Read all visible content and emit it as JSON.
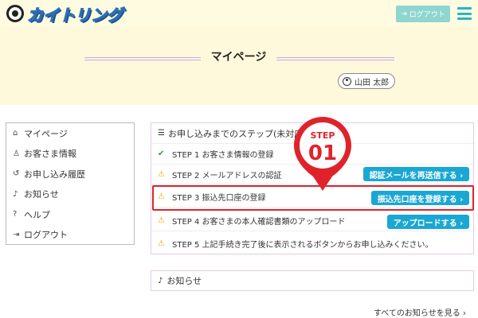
{
  "header": {
    "logo_text": "カイトリング",
    "logout_label": "ログアウト"
  },
  "hero": {
    "title": "マイページ",
    "user_name": "山田 太郎"
  },
  "sidebar": {
    "items": [
      {
        "icon": "home-icon",
        "label": "マイページ"
      },
      {
        "icon": "user-icon",
        "label": "お客さま情報"
      },
      {
        "icon": "history-icon",
        "label": "お申し込み履歴"
      },
      {
        "icon": "bell-icon",
        "label": "お知らせ"
      },
      {
        "icon": "help-icon",
        "label": "ヘルプ"
      },
      {
        "icon": "logout-icon",
        "label": "ログアウト"
      }
    ]
  },
  "steps": {
    "heading": "お申し込みまでのステップ(未対応の",
    "rows": [
      {
        "status": "done",
        "label": "STEP 1  お客さま情報の登録"
      },
      {
        "status": "todo",
        "label": "STEP 2  メールアドレスの認証",
        "button": "認証メールを再送信する ›"
      },
      {
        "status": "todo",
        "label": "STEP 3  振込先口座の登録",
        "button": "振込先口座を登録する ›"
      },
      {
        "status": "todo",
        "label": "STEP 4  お客さまの本人確認書類のアップロード",
        "button": "アップロードする ›"
      },
      {
        "status": "todo",
        "label": "STEP 5  上記手続き完了後に表示されるボタンからお申し込みください。"
      }
    ]
  },
  "badge": {
    "step_word": "STEP",
    "step_number": "01"
  },
  "news": {
    "heading": "お知らせ",
    "see_all": "すべてのお知らせを見る ›"
  },
  "colors": {
    "accent": "#1ba7d3",
    "highlight": "#e0232b",
    "hero_bg": "#fff9dc"
  }
}
